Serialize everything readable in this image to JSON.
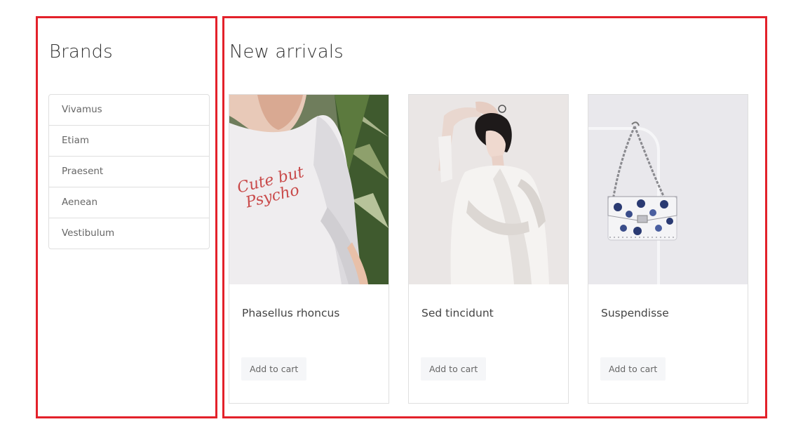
{
  "brands": {
    "title": "Brands",
    "items": [
      "Vivamus",
      "Etiam",
      "Praesent",
      "Aenean",
      "Vestibulum"
    ]
  },
  "arrivals": {
    "title": "New arrivals",
    "products": [
      {
        "name": "Phasellus rhoncus",
        "button": "Add to cart",
        "image": "sweatshirt-photo",
        "shirt_text": "Cute but Psycho"
      },
      {
        "name": "Sed tincidunt",
        "button": "Add to cart",
        "image": "model-photo"
      },
      {
        "name": "Suspendisse",
        "button": "Add to cart",
        "image": "handbag-photo"
      }
    ]
  },
  "colors": {
    "highlight_border": "#e3212a",
    "card_border": "#dfdfdf",
    "button_bg": "#f5f6f8"
  }
}
